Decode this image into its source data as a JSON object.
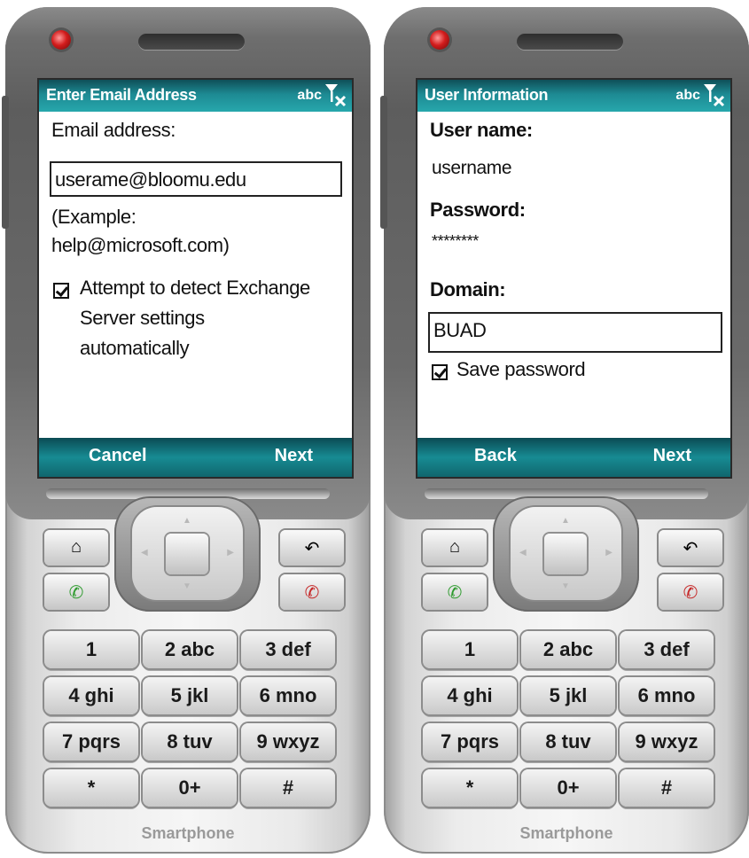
{
  "phones": [
    {
      "title": "Enter Email Address",
      "input_mode": "abc",
      "email_label": "Email address:",
      "email_value": "userame@bloomu.edu",
      "example_line1": "(Example:",
      "example_line2": "help@microsoft.com)",
      "detect_checked": true,
      "detect_line1": "Attempt to detect Exchange",
      "detect_line2": "Server settings",
      "detect_line3": "automatically",
      "left_soft": "Cancel",
      "right_soft": "Next"
    },
    {
      "title": "User Information",
      "input_mode": "abc",
      "username_label": "User name:",
      "username_value": "username",
      "password_label": "Password:",
      "password_value": "********",
      "domain_label": "Domain:",
      "domain_value": "BUAD",
      "save_checked": true,
      "save_label": "Save password",
      "left_soft": "Back",
      "right_soft": "Next"
    }
  ],
  "keypad": [
    [
      "1",
      "2 abc",
      "3 def"
    ],
    [
      "4 ghi",
      "5 jkl",
      "6 mno"
    ],
    [
      "7 pqrs",
      "8 tuv",
      "9 wxyz"
    ],
    [
      "*",
      "0+",
      "#"
    ]
  ],
  "brand": "Smartphone",
  "colors": {
    "titlebar": "#1d8a93",
    "softbar": "#178b93",
    "call_green": "#2e9b2e",
    "end_red": "#c62828"
  },
  "icons": {
    "home": "home-icon",
    "back": "back-arrow-icon",
    "call": "call-icon",
    "end": "end-call-icon",
    "signal": "no-signal-icon"
  }
}
